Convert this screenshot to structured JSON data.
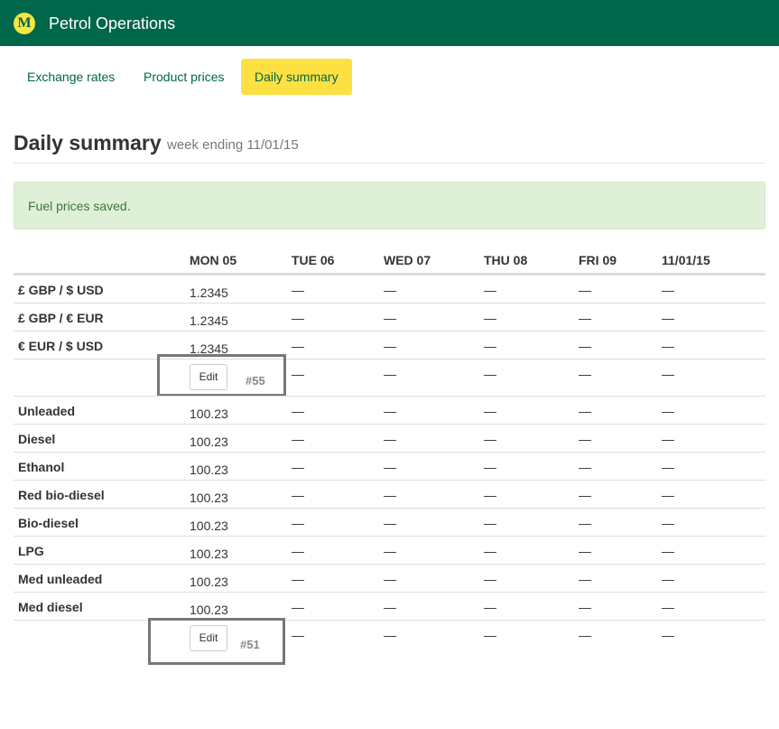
{
  "app": {
    "logo_letter": "M",
    "title": "Petrol Operations"
  },
  "nav": {
    "tabs": [
      {
        "label": "Exchange rates",
        "active": false
      },
      {
        "label": "Product prices",
        "active": false
      },
      {
        "label": "Daily summary",
        "active": true
      }
    ]
  },
  "page": {
    "title": "Daily summary",
    "subtitle": "week ending 11/01/15"
  },
  "alert": {
    "message": "Fuel prices saved."
  },
  "table": {
    "columns": [
      "MON 05",
      "TUE 06",
      "WED 07",
      "THU 08",
      "FRI 09",
      "11/01/15"
    ],
    "exchange_rows": [
      {
        "label": "£ GBP / $ USD",
        "values": [
          "1.2345",
          "—",
          "—",
          "—",
          "—",
          "—"
        ]
      },
      {
        "label": "£ GBP / € EUR",
        "values": [
          "1.2345",
          "—",
          "—",
          "—",
          "—",
          "—"
        ]
      },
      {
        "label": "€ EUR / $ USD",
        "values": [
          "1.2345",
          "—",
          "—",
          "—",
          "—",
          "—"
        ]
      }
    ],
    "exchange_edit": {
      "button": "Edit",
      "ref": "#55",
      "dashes": [
        "—",
        "—",
        "—",
        "—",
        "—"
      ]
    },
    "product_rows": [
      {
        "label": "Unleaded",
        "values": [
          "100.23",
          "—",
          "—",
          "—",
          "—",
          "—"
        ]
      },
      {
        "label": "Diesel",
        "values": [
          "100.23",
          "—",
          "—",
          "—",
          "—",
          "—"
        ]
      },
      {
        "label": "Ethanol",
        "values": [
          "100.23",
          "—",
          "—",
          "—",
          "—",
          "—"
        ]
      },
      {
        "label": "Red bio-diesel",
        "values": [
          "100.23",
          "—",
          "—",
          "—",
          "—",
          "—"
        ]
      },
      {
        "label": "Bio-diesel",
        "values": [
          "100.23",
          "—",
          "—",
          "—",
          "—",
          "—"
        ]
      },
      {
        "label": "LPG",
        "values": [
          "100.23",
          "—",
          "—",
          "—",
          "—",
          "—"
        ]
      },
      {
        "label": "Med unleaded",
        "values": [
          "100.23",
          "—",
          "—",
          "—",
          "—",
          "—"
        ]
      },
      {
        "label": "Med diesel",
        "values": [
          "100.23",
          "—",
          "—",
          "—",
          "—",
          "—"
        ]
      }
    ],
    "product_edit": {
      "button": "Edit",
      "ref": "#51",
      "dashes": [
        "—",
        "—",
        "—",
        "—",
        "—"
      ]
    }
  },
  "colors": {
    "brand_green": "#00674a",
    "brand_yellow": "#fde042",
    "success_bg": "#dff0d8",
    "success_text": "#3c763d"
  }
}
